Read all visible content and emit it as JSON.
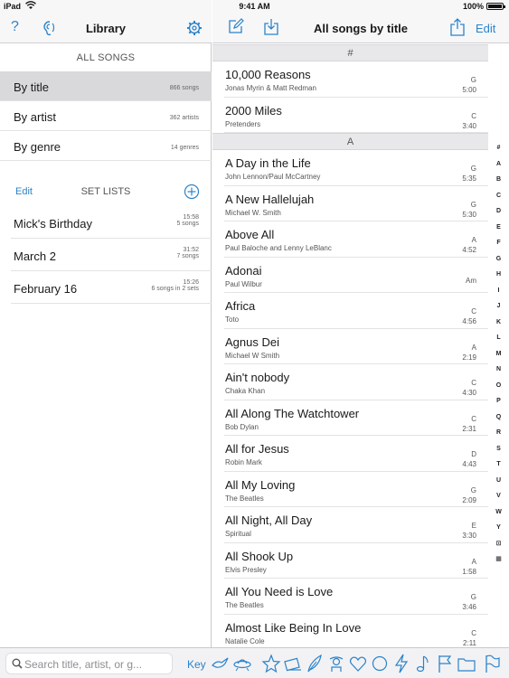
{
  "status": {
    "carrier": "iPad",
    "time": "9:41 AM",
    "battery": "100%"
  },
  "left": {
    "title": "Library",
    "help": "?",
    "all_songs_header": "ALL SONGS",
    "browse": [
      {
        "label": "By title",
        "count": "866 songs",
        "selected": true
      },
      {
        "label": "By artist",
        "count": "362 artists",
        "selected": false
      },
      {
        "label": "By genre",
        "count": "14 genres",
        "selected": false
      }
    ],
    "setlists_edit": "Edit",
    "setlists_header": "SET LISTS",
    "setlists": [
      {
        "name": "Mick's Birthday",
        "duration": "15:58",
        "count": "5 songs"
      },
      {
        "name": "March 2",
        "duration": "31:52",
        "count": "7 songs"
      },
      {
        "name": "February 16",
        "duration": "15:26",
        "count": "6 songs in 2 sets"
      }
    ]
  },
  "right": {
    "title": "All songs by title",
    "edit": "Edit",
    "sections": [
      {
        "letter": "#",
        "songs": [
          {
            "title": "10,000 Reasons",
            "artist": "Jonas Myrin & Matt Redman",
            "key": "G",
            "duration": "5:00"
          },
          {
            "title": "2000 Miles",
            "artist": "Pretenders",
            "key": "C",
            "duration": "3:40"
          }
        ]
      },
      {
        "letter": "A",
        "songs": [
          {
            "title": "A Day in the Life",
            "artist": "John Lennon/Paul McCartney",
            "key": "G",
            "duration": "5:35"
          },
          {
            "title": "A New Hallelujah",
            "artist": "Michael W. Smith",
            "key": "G",
            "duration": "5:30"
          },
          {
            "title": "Above All",
            "artist": "Paul Baloche and Lenny LeBlanc",
            "key": "A",
            "duration": "4:52"
          },
          {
            "title": "Adonai",
            "artist": "Paul Wilbur",
            "key": "Am",
            "duration": ""
          },
          {
            "title": "Africa",
            "artist": "Toto",
            "key": "C",
            "duration": "4:56"
          },
          {
            "title": "Agnus Dei",
            "artist": "Michael W Smith",
            "key": "A",
            "duration": "2:19"
          },
          {
            "title": "Ain't nobody",
            "artist": "Chaka Khan",
            "key": "C",
            "duration": "4:30"
          },
          {
            "title": "All Along The Watchtower",
            "artist": "Bob Dylan",
            "key": "C",
            "duration": "2:31"
          },
          {
            "title": "All for Jesus",
            "artist": "Robin Mark",
            "key": "D",
            "duration": "4:43"
          },
          {
            "title": "All My Loving",
            "artist": "The Beatles",
            "key": "G",
            "duration": "2:09"
          },
          {
            "title": "All Night, All Day",
            "artist": "Spiritual",
            "key": "E",
            "duration": "3:30"
          },
          {
            "title": "All Shook Up",
            "artist": "Elvis Presley",
            "key": "A",
            "duration": "1:58"
          },
          {
            "title": "All You Need is Love",
            "artist": "The Beatles",
            "key": "G",
            "duration": "3:46"
          },
          {
            "title": "Almost Like Being In Love",
            "artist": "Natalie Cole",
            "key": "C",
            "duration": "2:11"
          }
        ]
      }
    ],
    "index": [
      "#",
      "A",
      "B",
      "C",
      "D",
      "E",
      "F",
      "G",
      "H",
      "I",
      "J",
      "K",
      "L",
      "M",
      "N",
      "O",
      "P",
      "Q",
      "R",
      "S",
      "T",
      "U",
      "V",
      "W",
      "Y",
      "⊡",
      "▦"
    ]
  },
  "bottom": {
    "search_placeholder": "Search title, artist, or g...",
    "key_label": "Key",
    "genre_icons": [
      "dove-icon",
      "ufo-icon",
      "star-icon",
      "books-icon",
      "feather-icon",
      "cowboy-icon",
      "heart-icon",
      "circle-icon",
      "lightning-icon",
      "music-note-icon",
      "flag-icon",
      "folder-icon",
      "flag-outline-icon"
    ]
  },
  "colors": {
    "accent": "#2c83c9",
    "selected_row": "#d9d9db",
    "section_bg": "#e8e8ea"
  }
}
